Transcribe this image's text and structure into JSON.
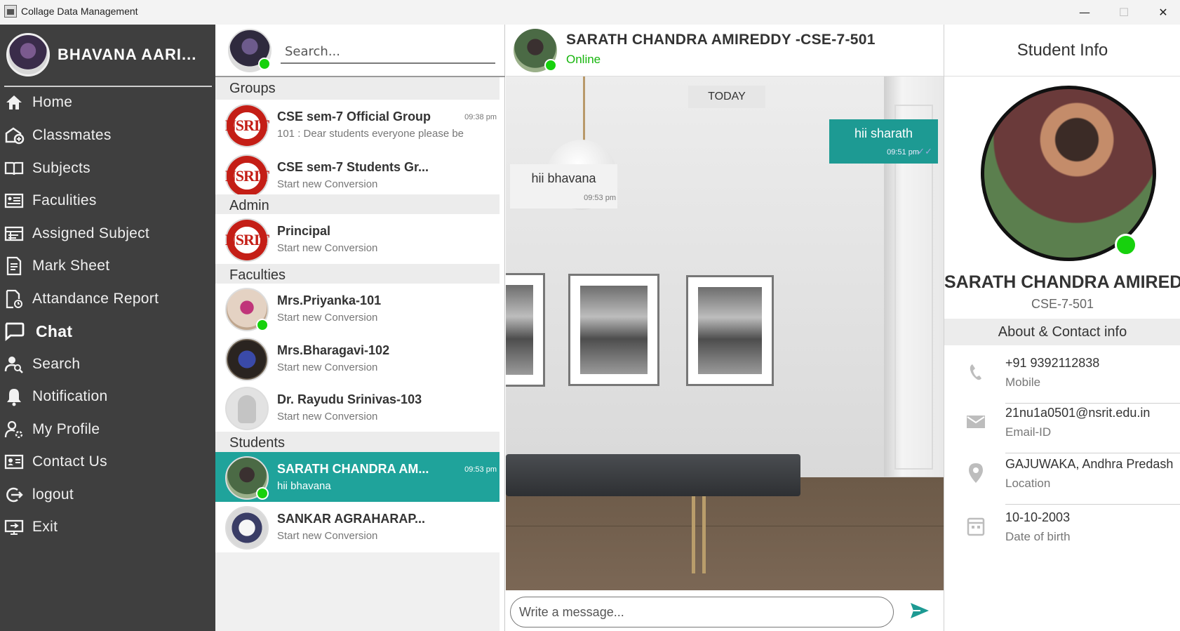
{
  "window": {
    "title": "Collage Data Management",
    "minimize": "—",
    "maximize": "☐",
    "close": "✕"
  },
  "sidebar": {
    "username": "BHAVANA AARI...",
    "items": [
      {
        "label": "Home",
        "icon": "home-icon"
      },
      {
        "label": "Classmates",
        "icon": "classmates-icon"
      },
      {
        "label": "Subjects",
        "icon": "book-icon"
      },
      {
        "label": "Faculities",
        "icon": "faculty-icon"
      },
      {
        "label": "Assigned Subject",
        "icon": "assigned-icon"
      },
      {
        "label": "Mark Sheet",
        "icon": "marksheet-icon"
      },
      {
        "label": "Attandance Report",
        "icon": "report-icon"
      },
      {
        "label": "Chat",
        "icon": "chat-icon",
        "active": true
      },
      {
        "label": "Search",
        "icon": "search-user-icon"
      },
      {
        "label": "Notification",
        "icon": "bell-icon"
      },
      {
        "label": "My Profile",
        "icon": "profile-settings-icon"
      },
      {
        "label": "Contact Us",
        "icon": "contact-card-icon"
      },
      {
        "label": "logout",
        "icon": "logout-icon"
      },
      {
        "label": "Exit",
        "icon": "exit-icon"
      }
    ]
  },
  "chat_list": {
    "search_placeholder": "Search...",
    "sections": {
      "groups": "Groups",
      "admin": "Admin",
      "faculties": "Faculties",
      "students": "Students"
    },
    "groups": [
      {
        "name": "CSE sem-7 Official Group",
        "message": "101 : Dear students everyone please be",
        "time": "09:38 pm"
      },
      {
        "name": "CSE sem-7 Students Gr...",
        "message": "Start new Conversion",
        "time": ""
      }
    ],
    "admin": [
      {
        "name": "Principal",
        "message": "Start new Conversion",
        "time": ""
      }
    ],
    "faculties": [
      {
        "name": "Mrs.Priyanka-101",
        "message": "Start new Conversion",
        "online": true
      },
      {
        "name": "Mrs.Bharagavi-102",
        "message": "Start new Conversion",
        "online": false
      },
      {
        "name": "Dr. Rayudu Srinivas-103",
        "message": "Start new Conversion",
        "online": false
      }
    ],
    "students": [
      {
        "name": "SARATH CHANDRA AM...",
        "message": "hii bhavana",
        "time": "09:53 pm",
        "selected": true,
        "online": true
      },
      {
        "name": "SANKAR AGRAHARAP...",
        "message": "Start new Conversion",
        "time": ""
      }
    ],
    "logo_text": "NSRIT"
  },
  "chat": {
    "contact_name": "SARATH CHANDRA AMIREDDY -CSE-7-501",
    "status": "Online",
    "date_chip": "TODAY",
    "messages": [
      {
        "direction": "out",
        "text": "hii sharath",
        "time": "09:51 pm"
      },
      {
        "direction": "in",
        "text": "hii bhavana",
        "time": "09:53 pm"
      }
    ],
    "input_placeholder": "Write a message..."
  },
  "info": {
    "header": "Student Info",
    "name": "SARATH CHANDRA AMIREDDY",
    "class": "CSE-7-501",
    "section_title": "About & Contact info",
    "rows": [
      {
        "value": "+91 9392112838",
        "label": "Mobile",
        "icon": "phone-icon"
      },
      {
        "value": "21nu1a0501@nsrit.edu.in",
        "label": "Email-ID",
        "icon": "mail-icon"
      },
      {
        "value": "GAJUWAKA, Andhra Predash",
        "label": "Location",
        "icon": "location-pin-icon"
      },
      {
        "value": "10-10-2003",
        "label": "Date of birth",
        "icon": "calendar-icon"
      }
    ]
  },
  "colors": {
    "accent": "#1fa39b",
    "sidebar": "#3f3f3f",
    "online": "#17d10d"
  }
}
